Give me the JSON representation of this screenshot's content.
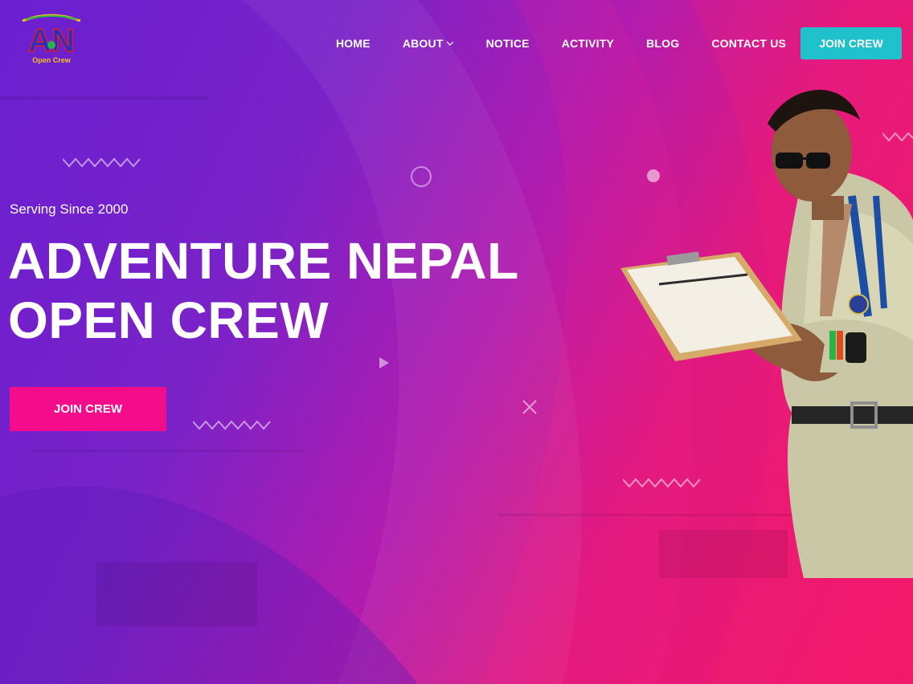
{
  "brand": {
    "logo_alt": "Adventure Nepal Open Crew logo",
    "logo_letters": "AN",
    "logo_caption": "Open Crew"
  },
  "nav": {
    "items": [
      {
        "label": "HOME",
        "name": "nav-home",
        "dropdown": false
      },
      {
        "label": "ABOUT",
        "name": "nav-about",
        "dropdown": true
      },
      {
        "label": "NOTICE",
        "name": "nav-notice",
        "dropdown": false
      },
      {
        "label": "ACTIVITY",
        "name": "nav-activity",
        "dropdown": false
      },
      {
        "label": "BLOG",
        "name": "nav-blog",
        "dropdown": false
      },
      {
        "label": "CONTACT US",
        "name": "nav-contact-us",
        "dropdown": false
      }
    ],
    "cta_label": "JOIN CREW"
  },
  "hero": {
    "tagline": "Serving Since 2000",
    "title_line1": "ADVENTURE NEPAL",
    "title_line2": "OPEN CREW",
    "cta_label": "JOIN CREW"
  },
  "colors": {
    "gradient_start": "#6a1fd0",
    "gradient_end": "#f21868",
    "nav_button": "#1fc1cc",
    "hero_button": "#f50c8a",
    "text": "#ffffff"
  },
  "icons": {
    "about_dropdown": "chevron-down-icon",
    "decor": [
      "zigzag-icon",
      "circle-outline-icon",
      "circle-icon",
      "play-triangle-icon",
      "close-x-icon"
    ]
  }
}
